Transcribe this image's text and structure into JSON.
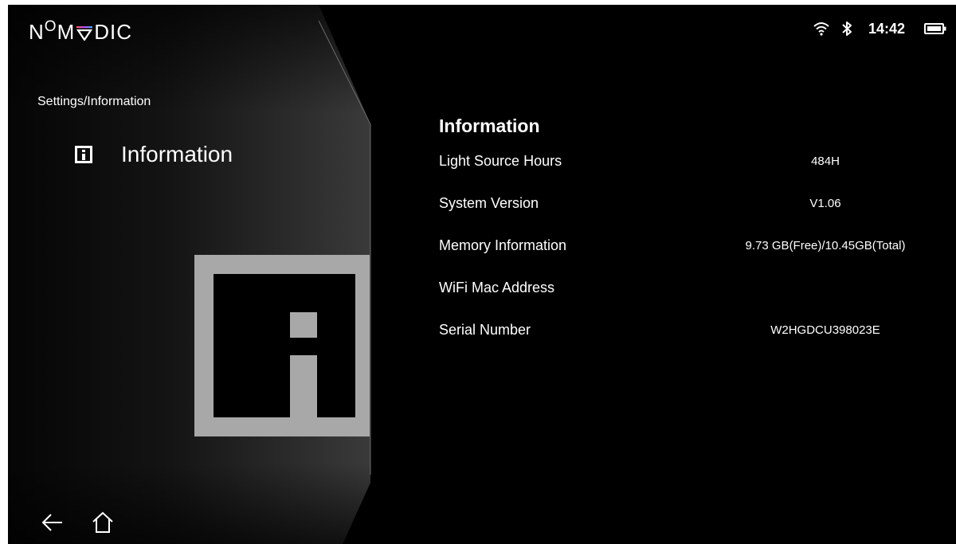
{
  "brand": {
    "logo_text_n": "N",
    "logo_text_o": "O",
    "logo_text_m": "M",
    "logo_text_rest": "DIC"
  },
  "status": {
    "time": "14:42",
    "icons": [
      "wifi-icon",
      "bluetooth-icon",
      "battery-icon"
    ]
  },
  "side": {
    "breadcrumb": "Settings/Information",
    "title": "Information",
    "icon": "info-icon"
  },
  "content": {
    "title": "Information",
    "rows": [
      {
        "label": "Light Source Hours",
        "value": "484H"
      },
      {
        "label": "System Version",
        "value": "V1.06"
      },
      {
        "label": "Memory Information",
        "value": "9.73 GB(Free)/10.45GB(Total)"
      },
      {
        "label": "WiFi Mac Address",
        "value": ""
      },
      {
        "label": "Serial Number",
        "value": "W2HGDCU398023E"
      }
    ]
  },
  "nav": {
    "back_icon": "back-arrow-icon",
    "home_icon": "home-icon"
  },
  "colors": {
    "background": "#000000",
    "text": "#ffffff",
    "icon_gray": "#a8a8a8"
  }
}
